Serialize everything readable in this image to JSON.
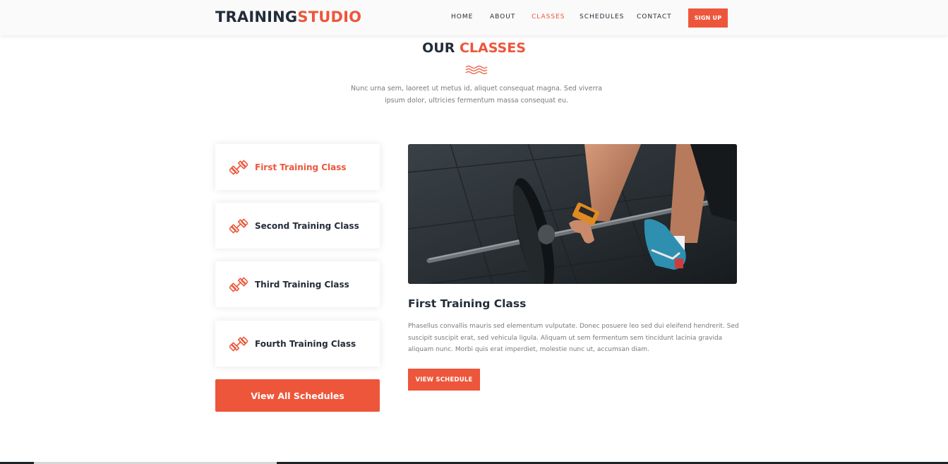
{
  "header": {
    "logo_main": "TRAINING",
    "logo_accent": "STUDIO",
    "nav": [
      {
        "label": "HOME",
        "active": false
      },
      {
        "label": "ABOUT",
        "active": false
      },
      {
        "label": "CLASSES",
        "active": true
      },
      {
        "label": "SCHEDULES",
        "active": false
      },
      {
        "label": "CONTACT",
        "active": false
      }
    ],
    "signup_label": "SIGN UP"
  },
  "section": {
    "title_main": "OUR",
    "title_accent": "CLASSES",
    "description": "Nunc urna sem, laoreet ut metus id, aliquet consequat magna. Sed viverra ipsum dolor, ultricies fermentum massa consequat eu."
  },
  "tabs": [
    {
      "label": "First Training Class",
      "icon": "dumbbell-icon",
      "active": true
    },
    {
      "label": "Second Training Class",
      "icon": "dumbbell-icon",
      "active": false
    },
    {
      "label": "Third Training Class",
      "icon": "dumbbell-icon",
      "active": false
    },
    {
      "label": "Fourth Training Class",
      "icon": "dumbbell-icon",
      "active": false
    }
  ],
  "view_all_label": "View All Schedules",
  "content": {
    "title": "First Training Class",
    "description": "Phasellus convallis mauris sed elementum vulputate. Donec posuere leo sed dui eleifend hendrerit. Sed suscipit suscipit erat, sed vehicula ligula. Aliquam ut sem fermentum sem tincidunt lacinia gravida aliquam nunc. Morbi quis erat imperdiet, molestie nunc ut, accumsan diam.",
    "button_label": "VIEW SCHEDULE"
  },
  "colors": {
    "accent": "#ed563b",
    "dark": "#232d39",
    "muted": "#7a7a7a"
  }
}
